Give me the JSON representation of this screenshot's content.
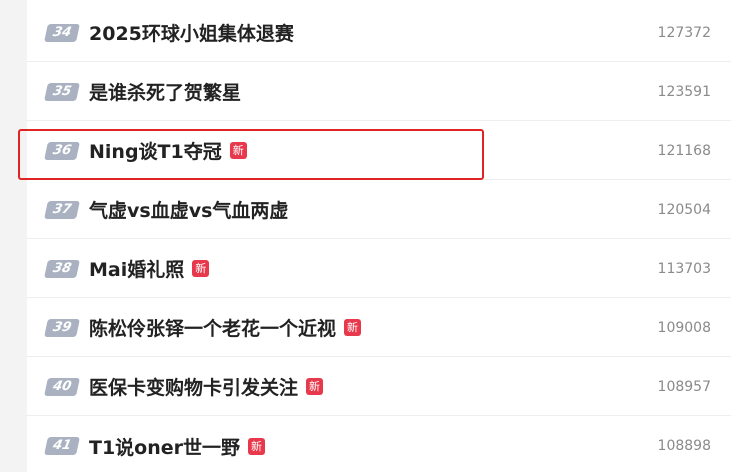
{
  "trending": {
    "items": [
      {
        "rank": "34",
        "title": "2025环球小姐集体退赛",
        "badge": "",
        "count": "127372"
      },
      {
        "rank": "35",
        "title": "是谁杀死了贺繁星",
        "badge": "",
        "count": "123591"
      },
      {
        "rank": "36",
        "title": "Ning谈T1夺冠",
        "badge": "新",
        "count": "121168"
      },
      {
        "rank": "37",
        "title": "气虚vs血虚vs气血两虚",
        "badge": "",
        "count": "120504"
      },
      {
        "rank": "38",
        "title": "Mai婚礼照",
        "badge": "新",
        "count": "113703"
      },
      {
        "rank": "39",
        "title": "陈松伶张铎一个老花一个近视",
        "badge": "新",
        "count": "109008"
      },
      {
        "rank": "40",
        "title": "医保卡变购物卡引发关注",
        "badge": "新",
        "count": "108957"
      },
      {
        "rank": "41",
        "title": "T1说oner世一野",
        "badge": "新",
        "count": "108898"
      }
    ]
  },
  "colors": {
    "rank_bg": "#aab2c2",
    "new_badge": "#e8394c",
    "highlight": "#e02424"
  }
}
